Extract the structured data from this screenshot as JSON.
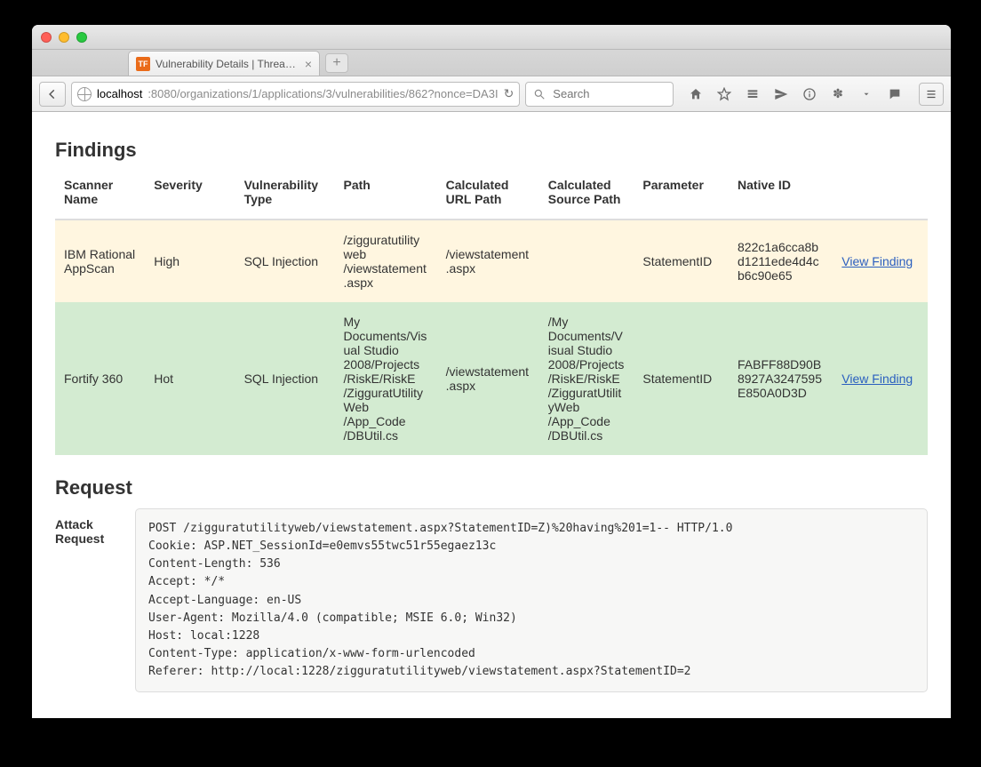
{
  "browser": {
    "tab_title": "Vulnerability Details | Threa…",
    "favicon_text": "TF",
    "url_host": "localhost",
    "url_path": ":8080/organizations/1/applications/3/vulnerabilities/862?nonce=DA3I",
    "search_placeholder": "Search"
  },
  "page": {
    "findings_heading": "Findings",
    "request_heading": "Request",
    "request_label": "Attack Request"
  },
  "columns": {
    "c0": "Scanner Name",
    "c1": "Severity",
    "c2": "Vulnerability Type",
    "c3": "Path",
    "c4": "Calculated URL Path",
    "c5": "Calculated Source Path",
    "c6": "Parameter",
    "c7": "Native ID",
    "c8": ""
  },
  "rows": [
    {
      "scanner": "IBM Rational AppScan",
      "severity": "High",
      "vtype": "SQL Injection",
      "path": "/zigguratutilityweb /viewstatement.aspx",
      "url_path": "/viewstatement.aspx",
      "source_path": "",
      "parameter": "StatementID",
      "native_id": "822c1a6cca8bd1211ede4d4cb6c90e65",
      "link": "View Finding"
    },
    {
      "scanner": "Fortify 360",
      "severity": "Hot",
      "vtype": "SQL Injection",
      "path": "My Documents/Visual Studio 2008/Projects /RiskE/RiskE /ZigguratUtilityWeb /App_Code /DBUtil.cs",
      "url_path": "/viewstatement.aspx",
      "source_path": "/My Documents/Visual Studio 2008/Projects /RiskE/RiskE /ZigguratUtilityWeb /App_Code /DBUtil.cs",
      "parameter": "StatementID",
      "native_id": "FABFF88D90B8927A3247595E850A0D3D",
      "link": "View Finding"
    }
  ],
  "request_body": "POST /zigguratutilityweb/viewstatement.aspx?StatementID=Z)%20having%201=1-- HTTP/1.0\nCookie: ASP.NET_SessionId=e0emvs55twc51r55egaez13c\nContent-Length: 536\nAccept: */*\nAccept-Language: en-US\nUser-Agent: Mozilla/4.0 (compatible; MSIE 6.0; Win32)\nHost: local:1228\nContent-Type: application/x-www-form-urlencoded\nReferer: http://local:1228/zigguratutilityweb/viewstatement.aspx?StatementID=2"
}
